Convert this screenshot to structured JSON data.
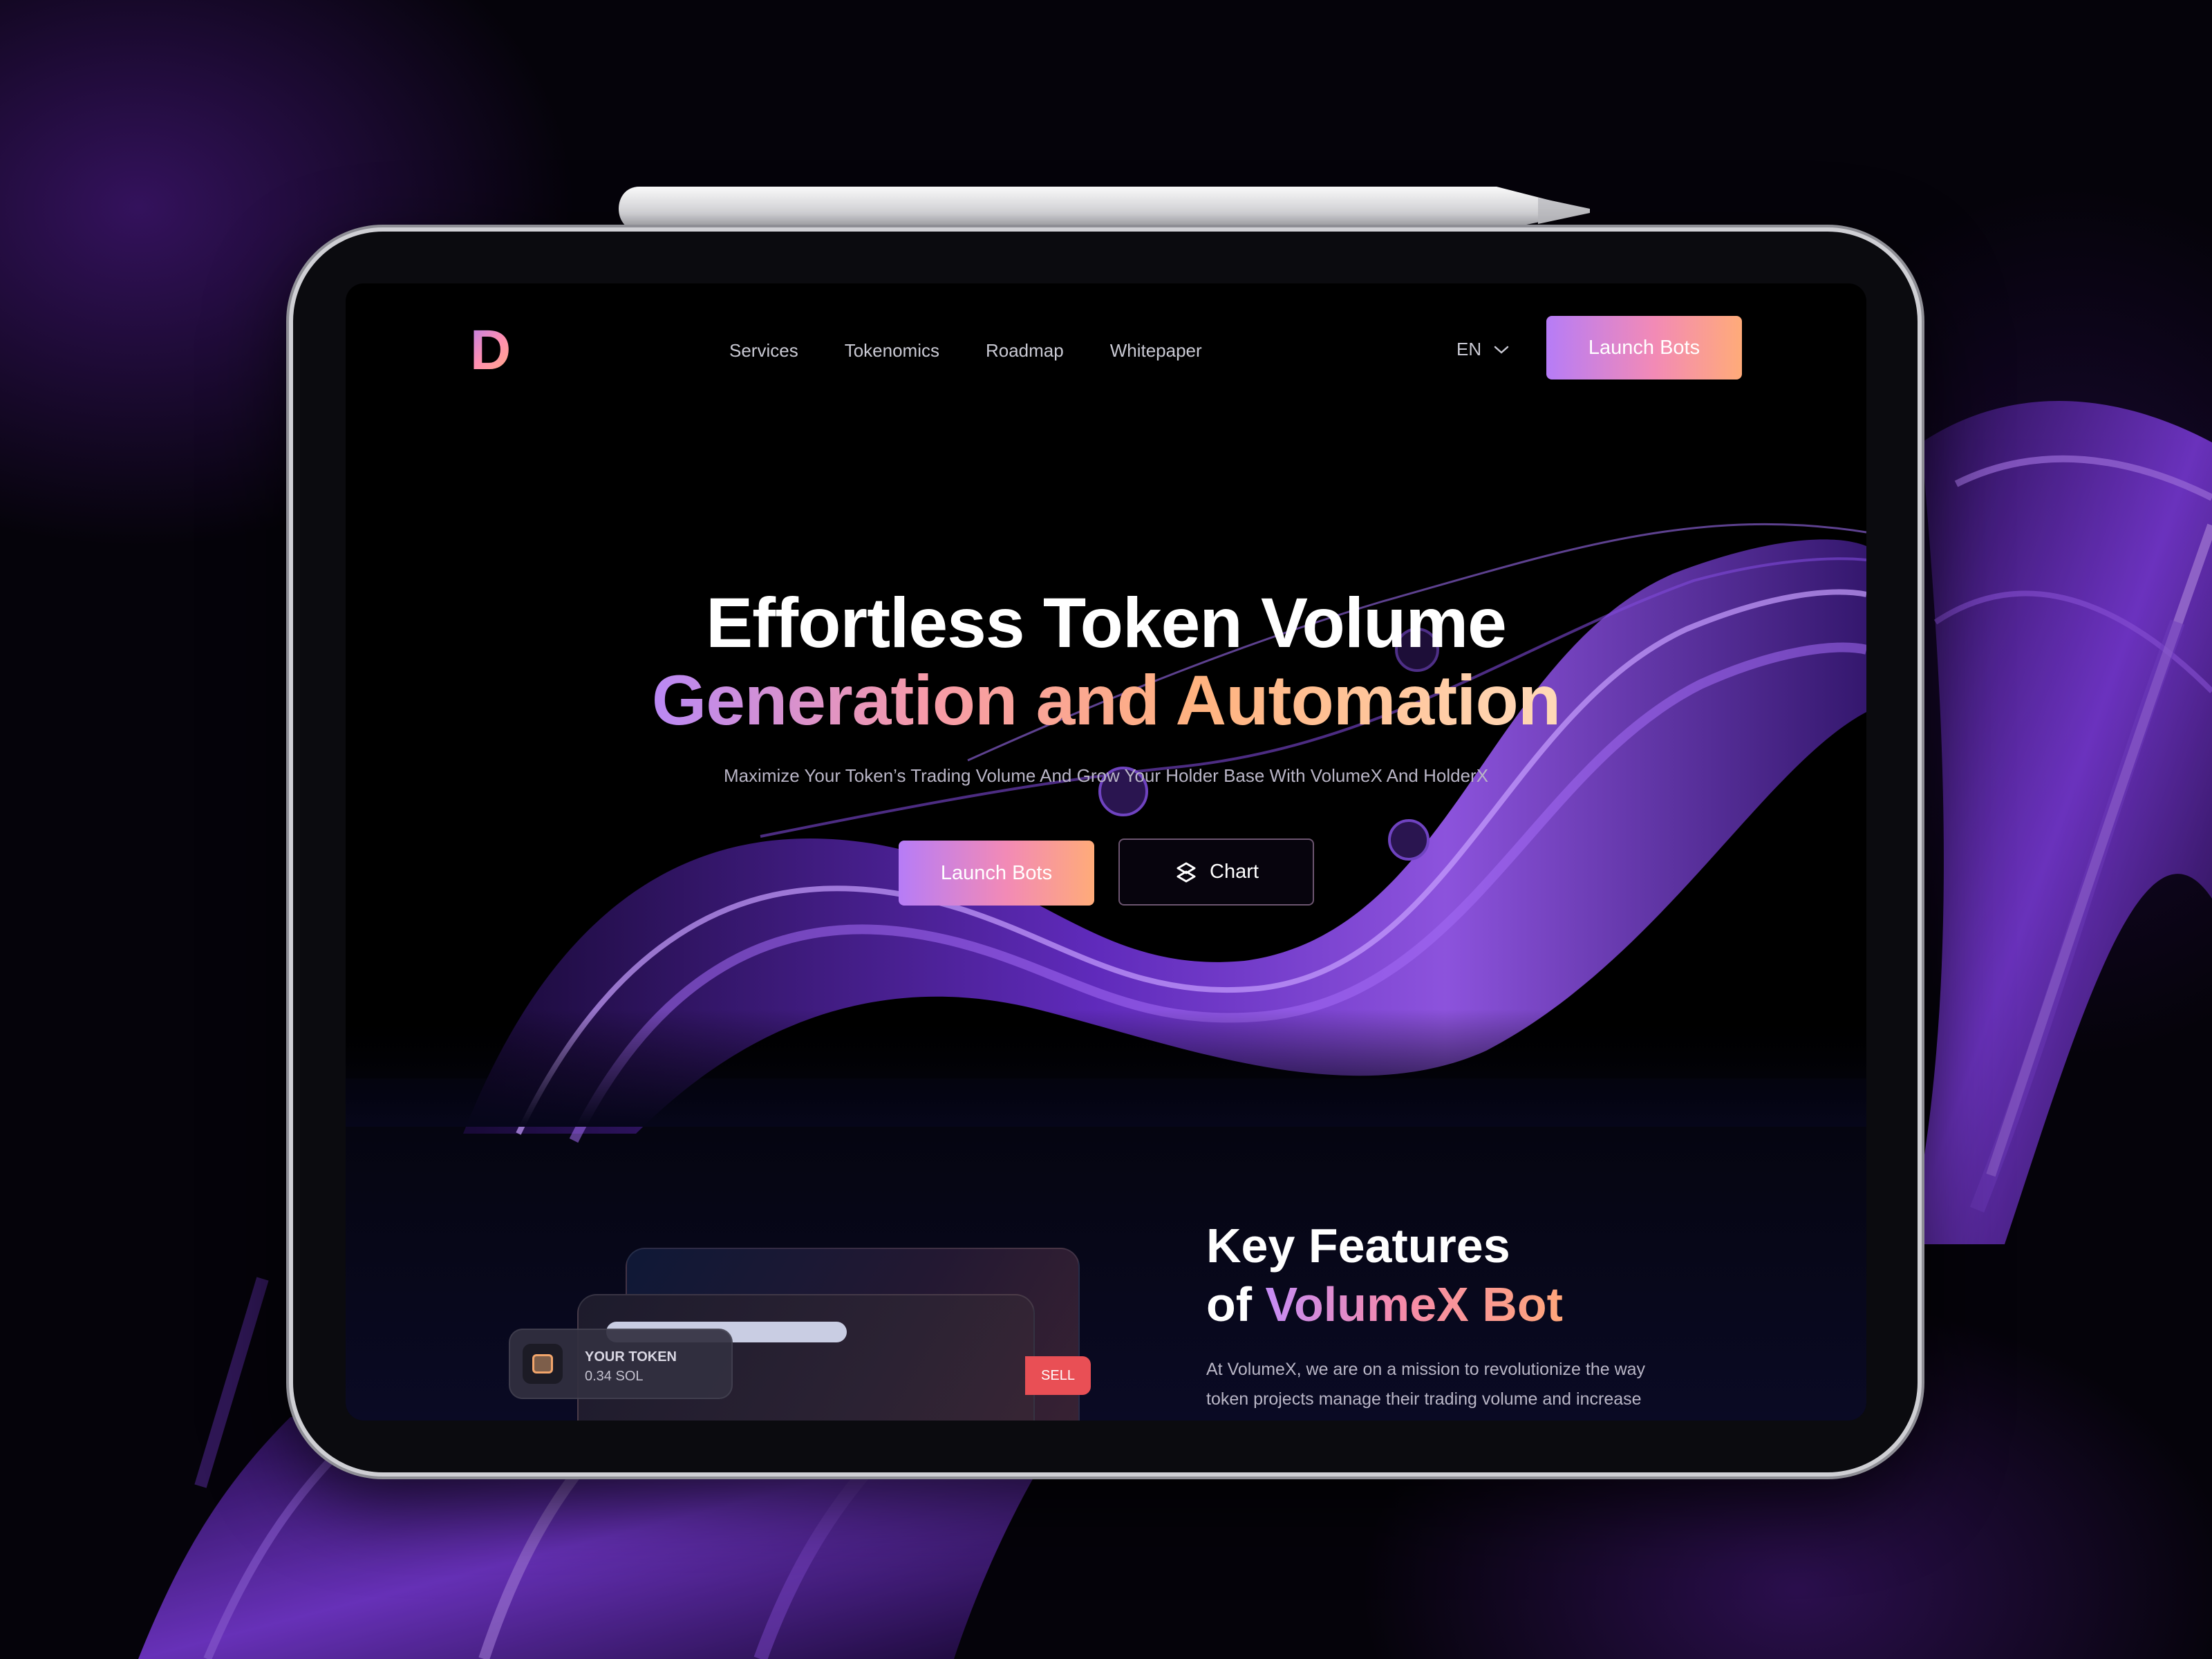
{
  "brand": {
    "logo_letter": "D"
  },
  "nav": {
    "items": [
      {
        "label": "Services"
      },
      {
        "label": "Tokenomics"
      },
      {
        "label": "Roadmap"
      },
      {
        "label": "Whitepaper"
      }
    ],
    "language": "EN",
    "cta_label": "Launch Bots"
  },
  "hero": {
    "title_line1": "Effortless Token Volume",
    "title_line2": "Generation and Automation",
    "subtitle": "Maximize Your Token’s Trading Volume And Grow Your Holder Base With VolumeX And HolderX",
    "primary_button": "Launch Bots",
    "secondary_button": "Chart"
  },
  "features": {
    "title_line1": "Key Features",
    "title_line2_prefix": "of ",
    "title_line2_highlight": "VolumeX Bot",
    "text_line1": "At VolumeX, we are on a mission to revolutionize the way",
    "text_line2": "token projects manage their trading volume and increase"
  },
  "card": {
    "token_label": "YOUR TOKEN",
    "token_value": "0.34 SOL",
    "sell_label": "SELL"
  },
  "colors": {
    "accent_start": "#b67cf7",
    "accent_mid": "#f28ab6",
    "accent_end": "#ffab79",
    "sell": "#e94f55",
    "background": "#000000"
  },
  "icons": {
    "chart_icon": "chart-icon",
    "chevron": "chevron-down-icon"
  }
}
